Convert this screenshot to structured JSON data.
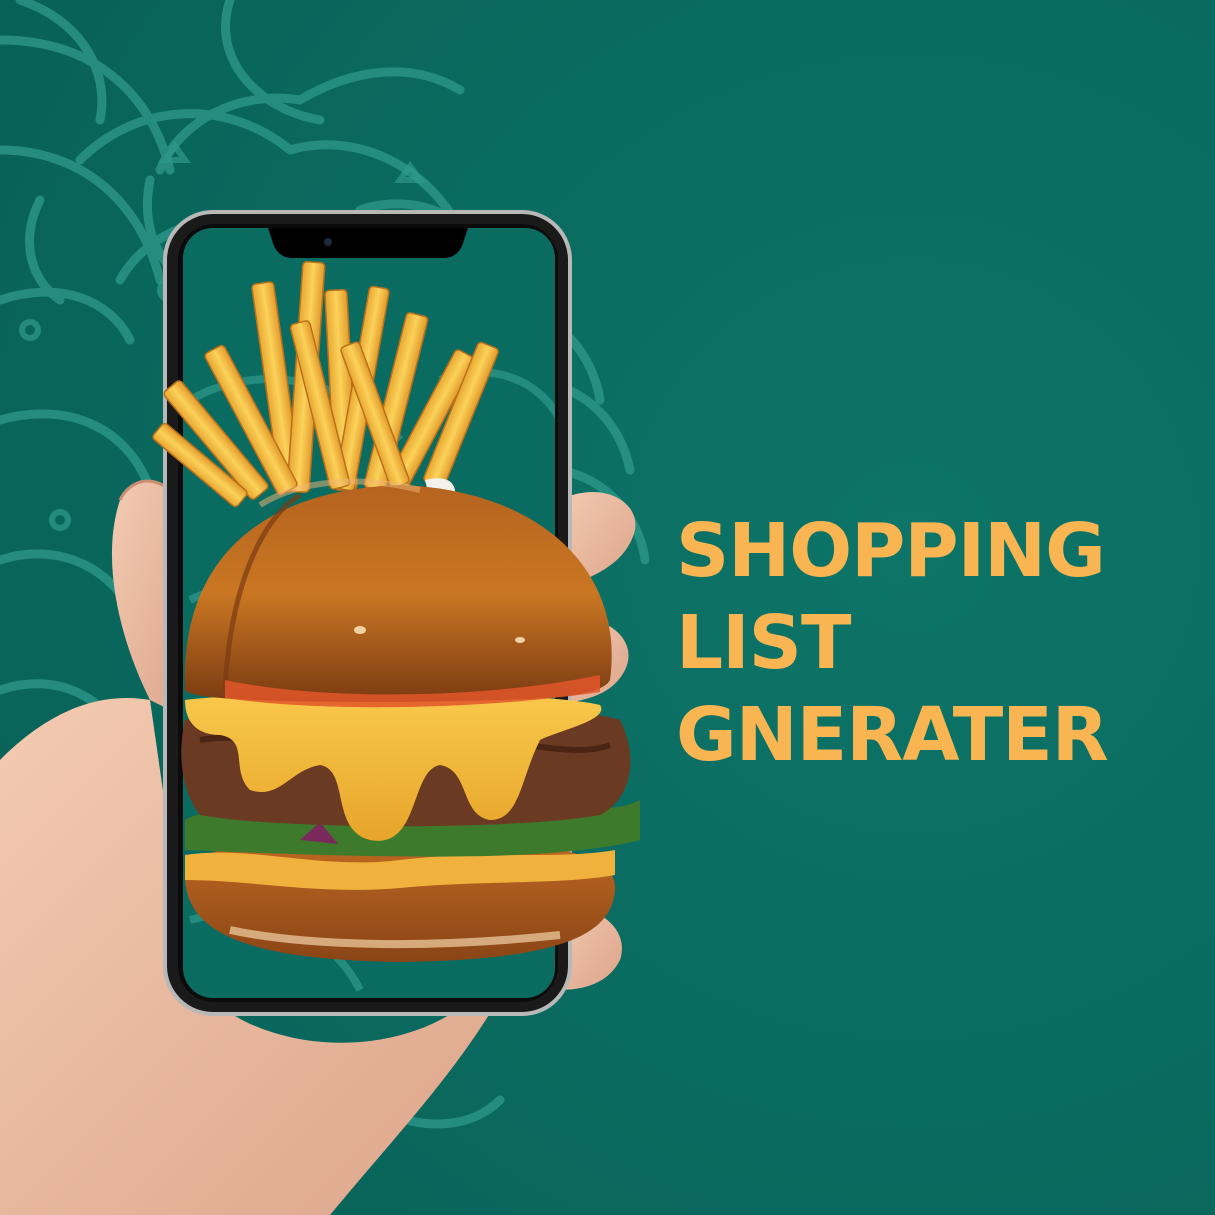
{
  "headline": {
    "lines": [
      "SHOPPING",
      "LIST",
      "GNERATER"
    ]
  },
  "colors": {
    "background": "#0a6b60",
    "headline": "#f8b552",
    "pattern": "#2f9a8c"
  },
  "illustration": {
    "subject": "hand-holding-phone-with-burger-and-fries"
  }
}
